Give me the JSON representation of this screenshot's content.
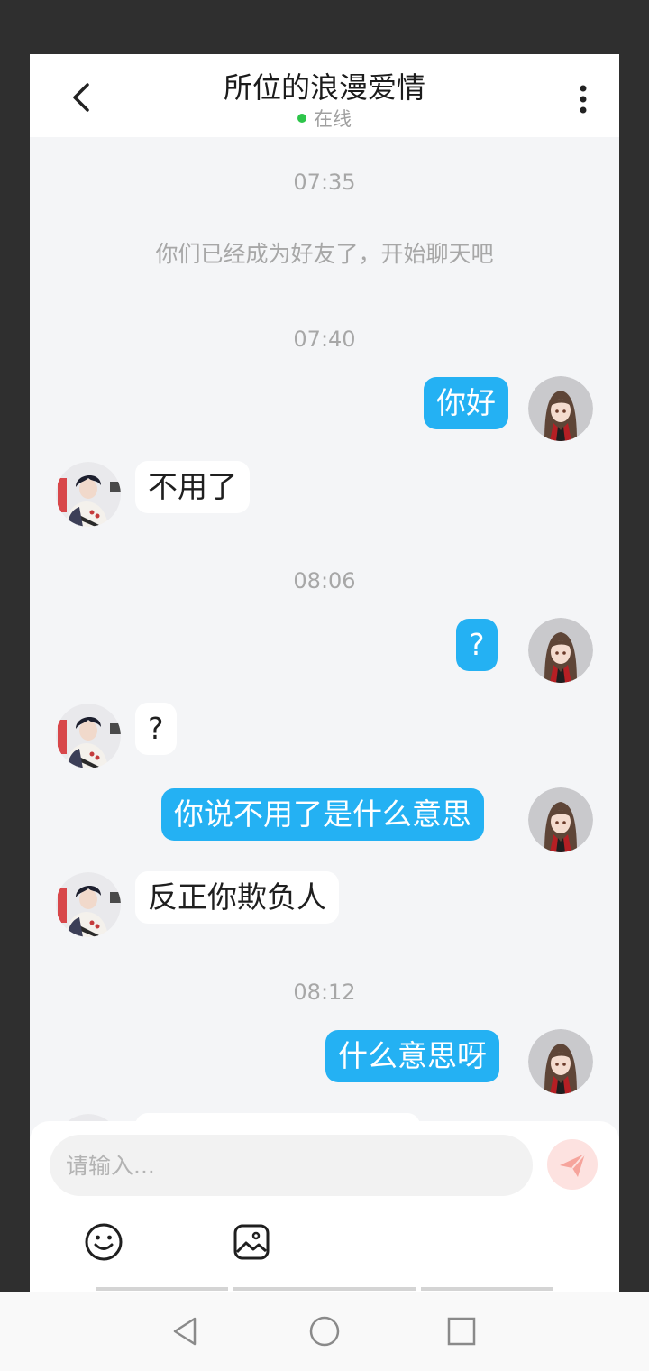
{
  "header": {
    "title": "所位的浪漫爱情",
    "status": "在线",
    "status_color": "#2dc54a"
  },
  "messages": [
    {
      "type": "time",
      "text": "07:35"
    },
    {
      "type": "system",
      "text": "你们已经成为好友了，开始聊天吧"
    },
    {
      "type": "time",
      "text": "07:40"
    },
    {
      "type": "text",
      "from": "me",
      "text": "你好"
    },
    {
      "type": "text",
      "from": "other",
      "text": "不用了"
    },
    {
      "type": "time",
      "text": "08:06"
    },
    {
      "type": "text",
      "from": "me",
      "text": "?"
    },
    {
      "type": "text",
      "from": "other",
      "text": "?"
    },
    {
      "type": "text",
      "from": "me",
      "text": "你说不用了是什么意思"
    },
    {
      "type": "text",
      "from": "other",
      "text": "反正你欺负人"
    },
    {
      "type": "time",
      "text": "08:12"
    },
    {
      "type": "text",
      "from": "me",
      "text": "什么意思呀"
    }
  ],
  "input": {
    "placeholder": "请输入...",
    "value": ""
  },
  "toolbar": {
    "emoji_icon": "smiley-icon",
    "image_icon": "image-icon",
    "send_icon": "paper-plane-icon"
  },
  "colors": {
    "my_bubble": "#24b1f3",
    "other_bubble": "#ffffff",
    "background": "#f4f5f7",
    "send_button": "#f6a49c"
  },
  "navbar": {
    "back_icon": "triangle-back-icon",
    "home_icon": "circle-home-icon",
    "recents_icon": "square-recents-icon"
  }
}
